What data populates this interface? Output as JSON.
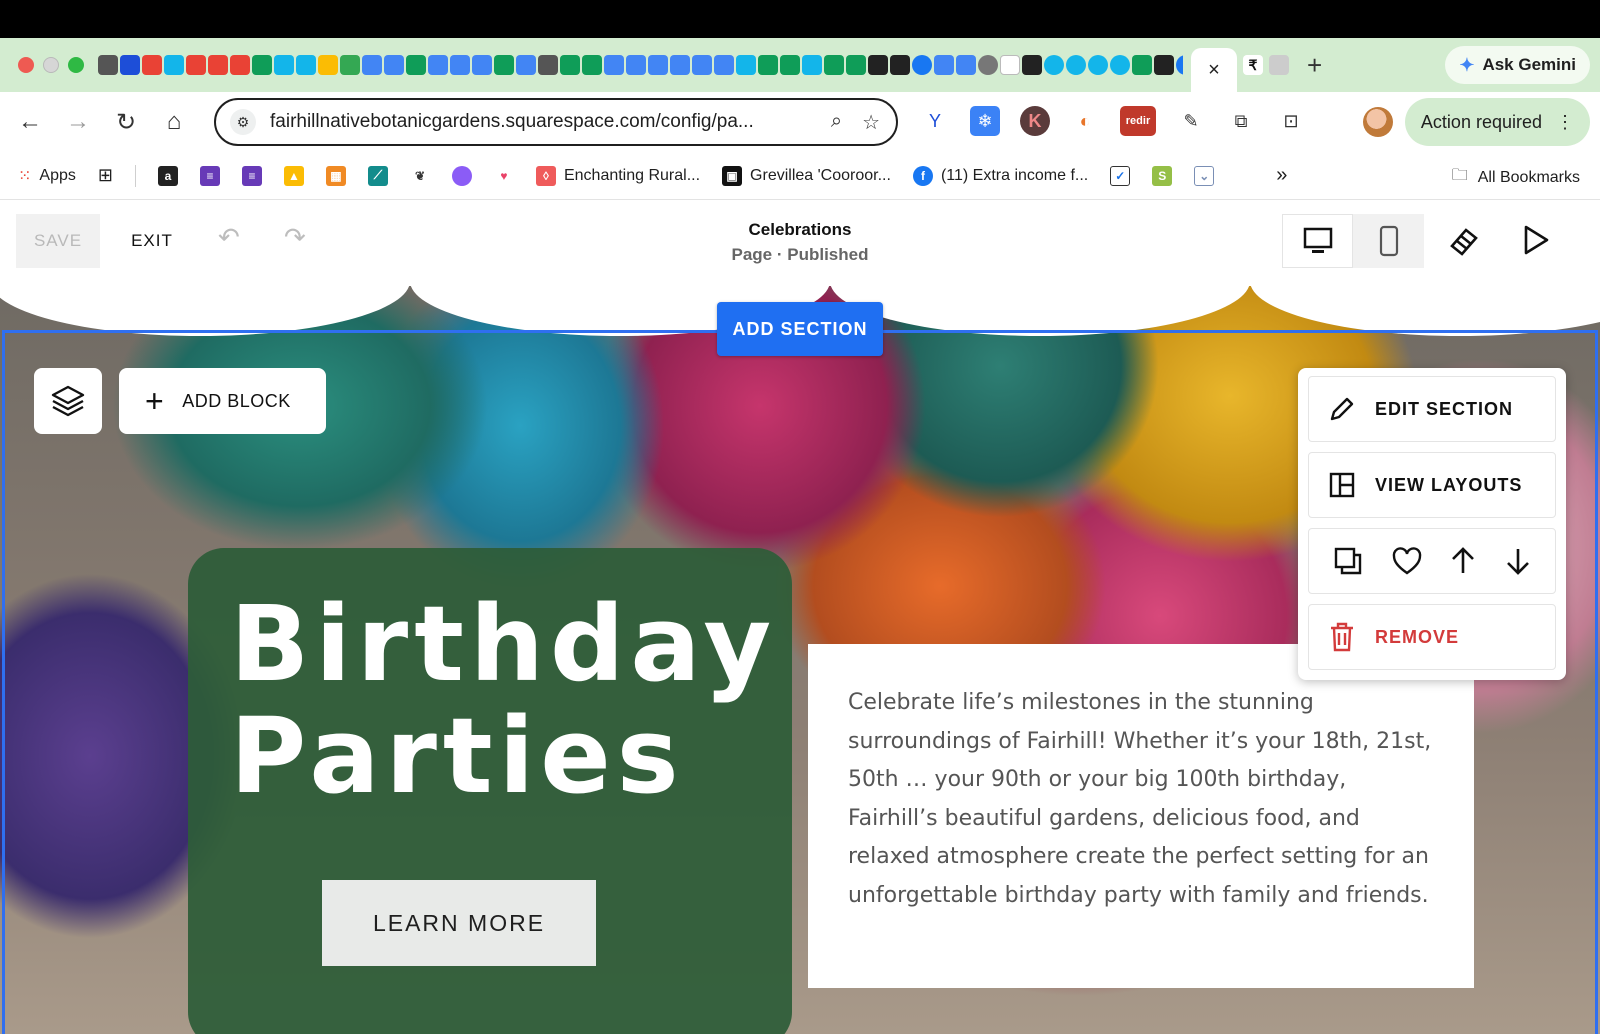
{
  "browser": {
    "tab_close": "×",
    "new_tab": "+",
    "ask_gemini": "Ask Gemini",
    "url": "fairhillnativebotanicgardens.squarespace.com/config/pa...",
    "action_required": "Action required",
    "extension_badge": "redir"
  },
  "bookmarks": {
    "apps": "Apps",
    "items": [
      "Enchanting Rural...",
      "Grevillea 'Cooroor...",
      "(11) Extra income f..."
    ],
    "overflow": "»",
    "all_bookmarks": "All Bookmarks"
  },
  "editor": {
    "save": "SAVE",
    "exit": "EXIT",
    "page_title": "Celebrations",
    "page_status": "Page · Published",
    "add_section": "ADD SECTION",
    "add_block": "ADD BLOCK",
    "menu": {
      "edit_section": "EDIT SECTION",
      "view_layouts": "VIEW LAYOUTS",
      "remove": "REMOVE"
    }
  },
  "hero": {
    "title_line1": "Birthday",
    "title_line2": "Parties",
    "cta": "LEARN MORE",
    "body": "Celebrate life’s milestones in the stunning surroundings of Fairhill! Whether it’s your 18th, 21st, 50th … your 90th or your big 100th birthday, Fairhill’s beautiful gardens, delicious food, and relaxed atmosphere create the perfect setting for an unforgettable birthday party with family and friends."
  },
  "colors": {
    "accent_blue": "#1f6ff2",
    "hero_green": "#2d5c38",
    "remove_red": "#d33b3b",
    "tab_strip": "#d3ecd0"
  }
}
